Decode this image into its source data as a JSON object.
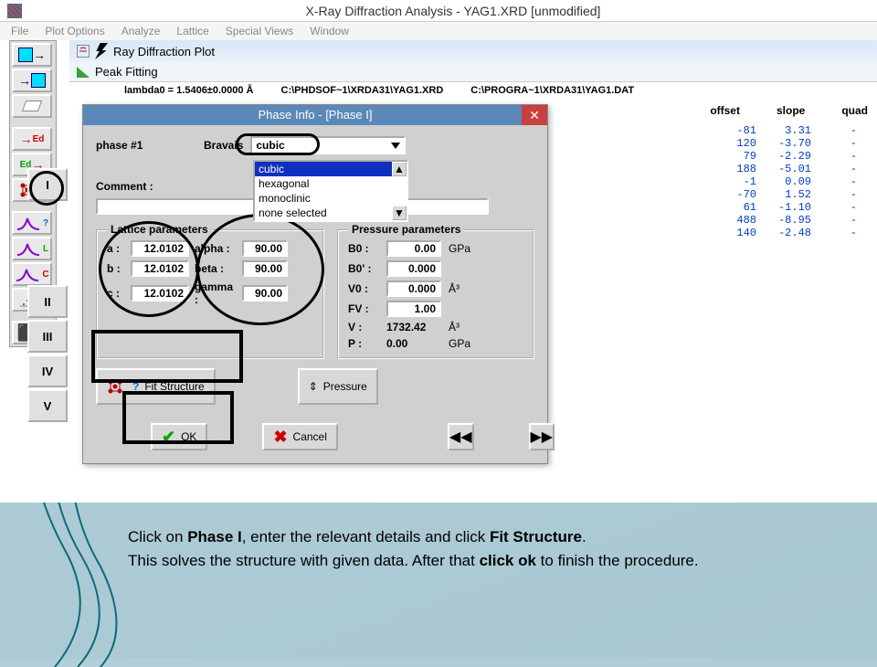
{
  "title": "X-Ray Diffraction Analysis - YAG1.XRD [unmodified]",
  "menu": [
    "File",
    "Plot Options",
    "Analyze",
    "Lattice",
    "Special Views",
    "Window"
  ],
  "docbars": {
    "plot": "Ray Diffraction Plot",
    "peak": "Peak Fitting"
  },
  "infoline": {
    "lambda": "lambda0 =  1.5406±0.0000 Å",
    "p1": "C:\\PHDSOF~1\\XRDA31\\YAG1.XRD",
    "p2": "C:\\PROGRA~1\\XRDA31\\YAG1.DAT"
  },
  "headers": [
    "offset",
    "slope",
    "quad"
  ],
  "rows": [
    {
      "offset": "-81",
      "slope": "3.31",
      "quad": "-"
    },
    {
      "offset": "120",
      "slope": "-3.70",
      "quad": "-"
    },
    {
      "offset": "79",
      "slope": "-2.29",
      "quad": "-"
    },
    {
      "offset": "188",
      "slope": "-5.01",
      "quad": "-"
    },
    {
      "offset": "-1",
      "slope": "0.09",
      "quad": "-"
    },
    {
      "offset": "-70",
      "slope": "1.52",
      "quad": "-"
    },
    {
      "offset": "61",
      "slope": "-1.10",
      "quad": "-"
    },
    {
      "offset": "488",
      "slope": "-8.95",
      "quad": "-"
    },
    {
      "offset": "140",
      "slope": "-2.48",
      "quad": "-"
    }
  ],
  "phases": [
    "I",
    "II",
    "III",
    "IV",
    "V"
  ],
  "dialog": {
    "title": "Phase Info - [Phase I]",
    "phaseLabel": "phase #1",
    "bravaisLabel": "Bravais",
    "bravaisValue": "cubic",
    "options": [
      "cubic",
      "hexagonal",
      "monoclinic",
      "none selected"
    ],
    "commentLabel": "Comment :",
    "commentValue": "",
    "latTitle": "Lattice parameters",
    "a": "12.0102",
    "b": "12.0102",
    "c": "12.0102",
    "alpha": "90.00",
    "beta": "90.00",
    "gamma": "90.00",
    "pressTitle": "Pressure parameters",
    "B0": "0.00",
    "B0u": "GPa",
    "B0p": "0.000",
    "V0": "0.000",
    "V0u": "Å³",
    "FV": "1.00",
    "Vlbl": "V :",
    "V": "1732.42",
    "Vu": "Å³",
    "Plbl": "P :",
    "P": "0.00",
    "Pu": "GPa",
    "fit": "Fit Structure",
    "pressure": "Pressure",
    "ok": "OK",
    "cancel": "Cancel"
  },
  "toolbar": {
    "Ed": "Ed"
  },
  "caption": {
    "l1a": "Click on ",
    "l1b": "Phase I",
    "l1c": ", enter the relevant details and click ",
    "l1d": "Fit Structure",
    "l1e": ".",
    "l2a": "This solves the structure with given data. After that ",
    "l2b": "click ok",
    "l2c": " to finish the procedure."
  }
}
